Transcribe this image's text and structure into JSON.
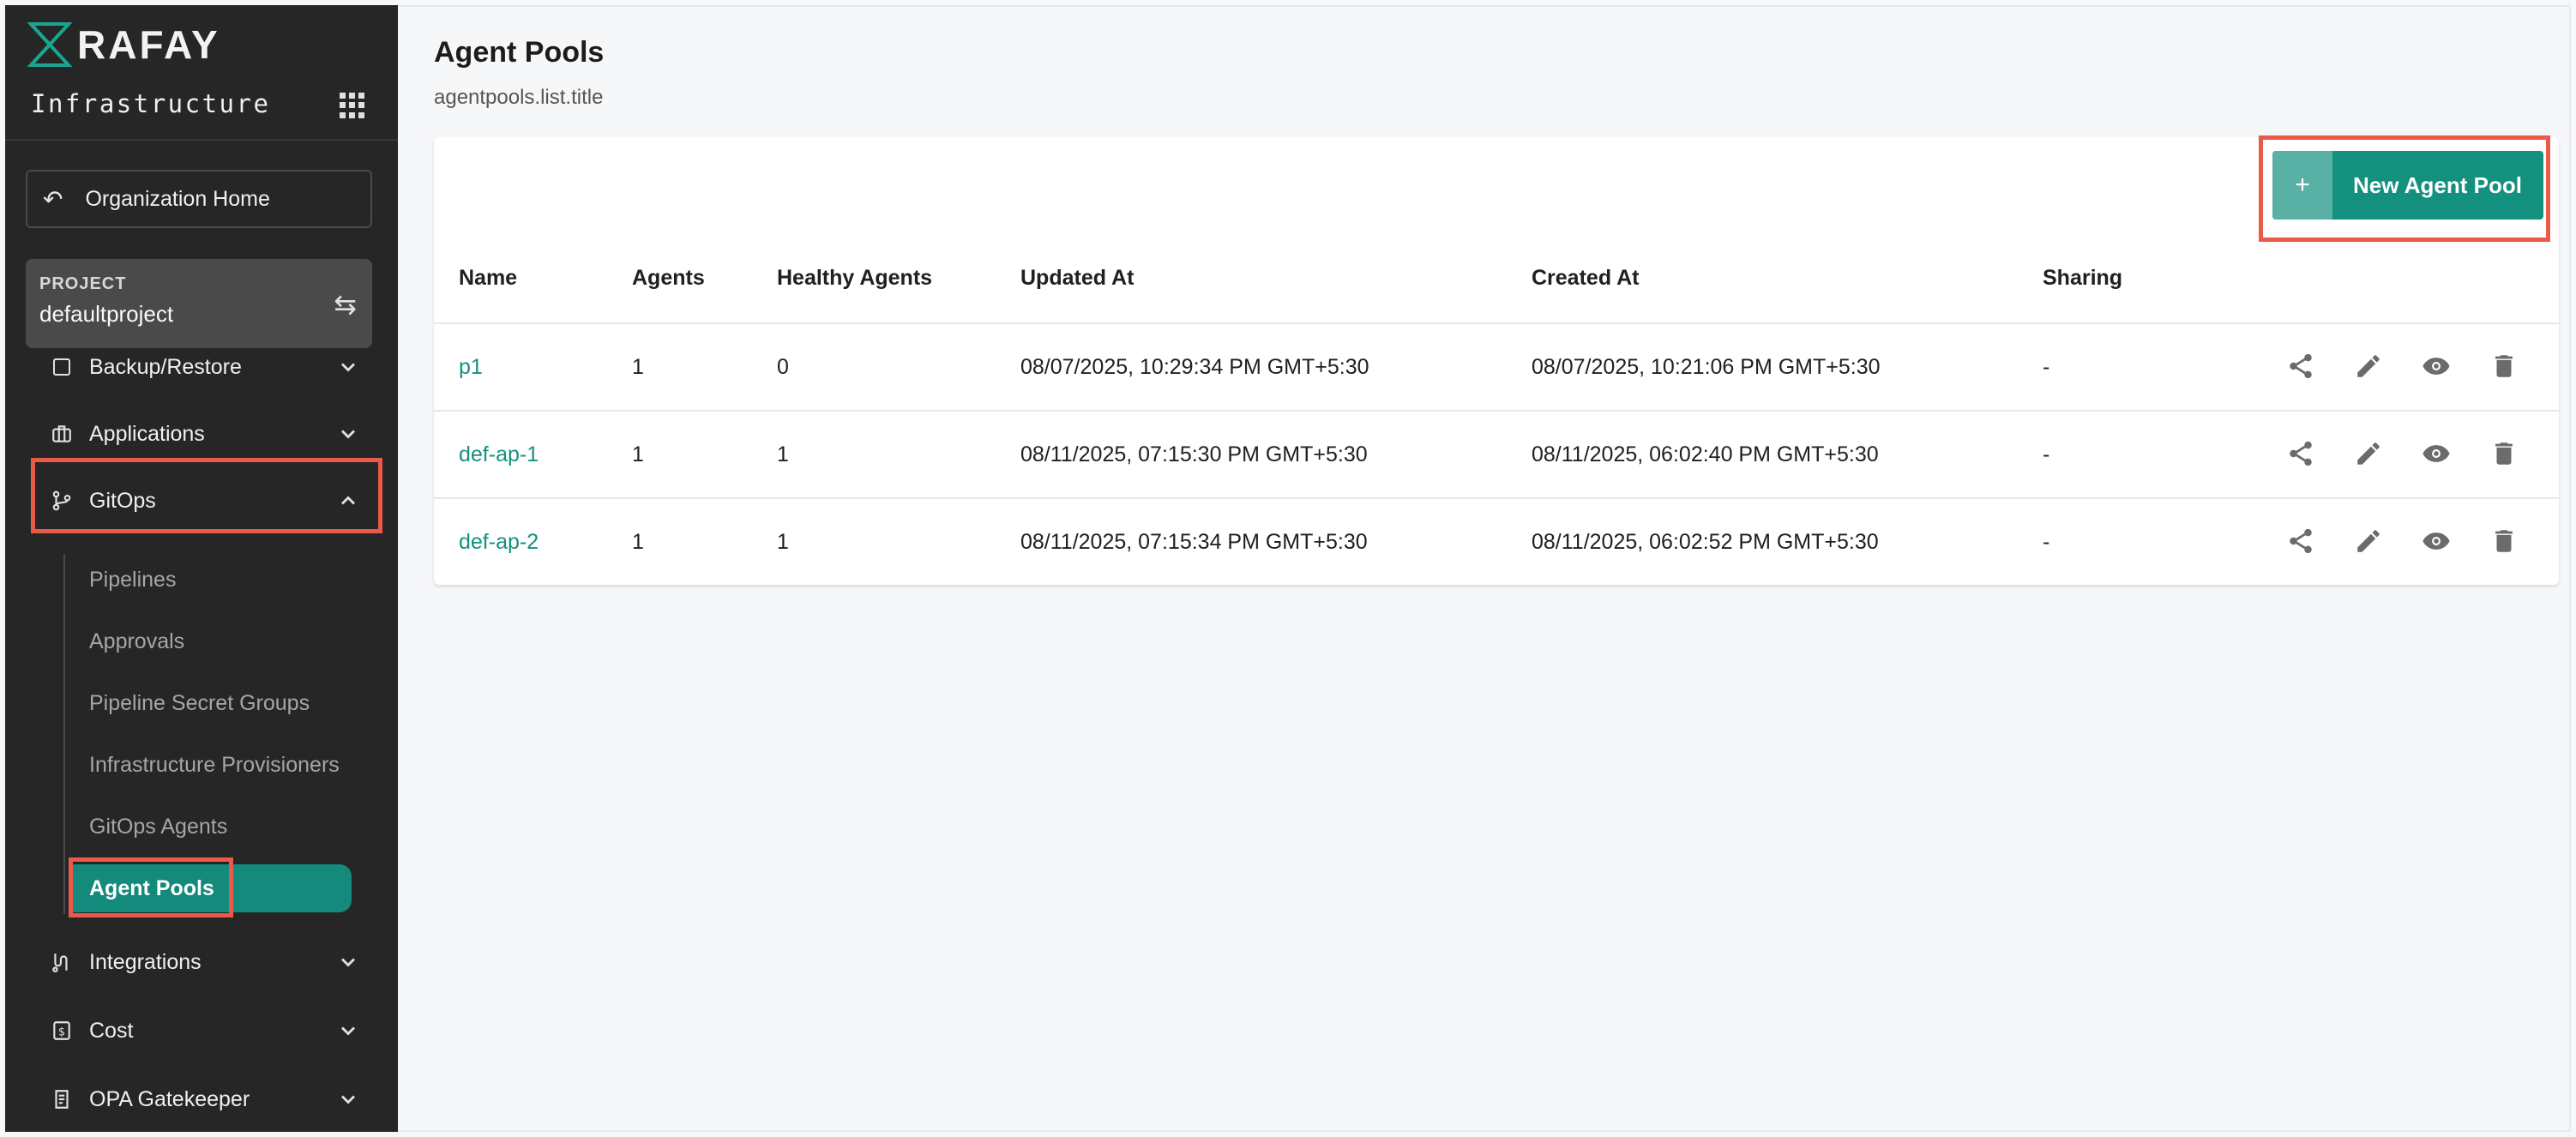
{
  "sidebar": {
    "brand": "RAFAY",
    "app_title": "Infrastructure",
    "org_home": "Organization Home",
    "project_label": "PROJECT",
    "project_name": "defaultproject",
    "nav": [
      {
        "label": "Backup/Restore"
      },
      {
        "label": "Applications"
      },
      {
        "label": "GitOps"
      },
      {
        "label": "Integrations"
      },
      {
        "label": "Cost"
      },
      {
        "label": "OPA Gatekeeper"
      }
    ],
    "gitops_sub": [
      "Pipelines",
      "Approvals",
      "Pipeline Secret Groups",
      "Infrastructure Provisioners",
      "GitOps Agents",
      "Agent Pools"
    ]
  },
  "main": {
    "title": "Agent Pools",
    "subtitle": "agentpools.list.title",
    "new_button": "New Agent Pool",
    "columns": [
      "Name",
      "Agents",
      "Healthy Agents",
      "Updated At",
      "Created At",
      "Sharing"
    ],
    "rows": [
      {
        "name": "p1",
        "agents": "1",
        "healthy": "0",
        "updated": "08/07/2025, 10:29:34 PM GMT+5:30",
        "created": "08/07/2025, 10:21:06 PM GMT+5:30",
        "sharing": "-"
      },
      {
        "name": "def-ap-1",
        "agents": "1",
        "healthy": "1",
        "updated": "08/11/2025, 07:15:30 PM GMT+5:30",
        "created": "08/11/2025, 06:02:40 PM GMT+5:30",
        "sharing": "-"
      },
      {
        "name": "def-ap-2",
        "agents": "1",
        "healthy": "1",
        "updated": "08/11/2025, 07:15:34 PM GMT+5:30",
        "created": "08/11/2025, 06:02:52 PM GMT+5:30",
        "sharing": "-"
      }
    ]
  },
  "colors": {
    "accent": "#14907f",
    "highlight": "#ea5a4a",
    "sidebar_bg": "#262626"
  }
}
